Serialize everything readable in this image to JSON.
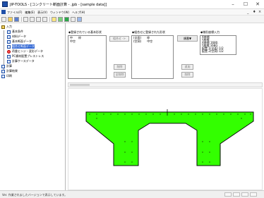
{
  "window": {
    "title": "JIP-TOOLS - [コンクリート断面計算 - .jpb - [sample data]]",
    "minimize_glyph": "–",
    "maximize_glyph": "☐",
    "close_glyph": "✕"
  },
  "menu": {
    "items": [
      "ファイル(F)",
      "編集(E)",
      "表示(V)",
      "ウィンドウ(W)",
      "ヘルプ(H)"
    ],
    "mdi_minimize": "_",
    "mdi_restore": "♦",
    "mdi_close": "×"
  },
  "tree": {
    "root_label": "入力",
    "items": [
      {
        "label": "基本条件",
        "icon": "document-icon"
      },
      {
        "label": "材料データ",
        "icon": "document-icon"
      },
      {
        "label": "基本断面データ",
        "icon": "document-icon"
      },
      {
        "label": "組合せ断面データ",
        "icon": "document-icon",
        "selected": true
      },
      {
        "label": "荷重ヒンジ・変形データ",
        "icon": "error-circle-icon"
      },
      {
        "label": "PC鋼材配置プレストレス",
        "icon": "document-icon"
      },
      {
        "label": "計算ケースデータ",
        "icon": "document-icon"
      }
    ],
    "bottom_items": [
      {
        "label": "計算",
        "icon": "document-icon"
      },
      {
        "label": "計算結果",
        "icon": "document-icon"
      },
      {
        "label": "印刷",
        "icon": "document-icon"
      }
    ]
  },
  "panels": {
    "registered": {
      "title": "◆登録されている基本形状",
      "rows": [
        [
          "中",
          "枠"
        ],
        [
          "中空",
          ""
        ]
      ],
      "add_button": "組合せ ->",
      "delete_button": "削除",
      "clear_button": "全削除"
    },
    "combined": {
      "title": "◆組合せに登録された形状",
      "rows": [
        [
          "(全面)",
          "枠"
        ],
        [
          "(空洞)",
          "中空"
        ]
      ],
      "order_button": "順番▼",
      "up_button": "追加",
      "remove_button": "削除"
    },
    "coords": {
      "title": "◆線形座標入力",
      "rows": [
        "X座標",
        "Y座標",
        "X座標 1680.",
        "Y座標 1680.",
        "配置 1(全面) 1/2",
        "配置 2(空洞) 1/2"
      ]
    }
  },
  "status": {
    "text": "Ver. 作業されましたバージョンで表示しています。"
  },
  "colors": {
    "shape_fill": "#33ff00",
    "shape_edge": "#0a0a0a",
    "selection": "#3a6ed6"
  }
}
